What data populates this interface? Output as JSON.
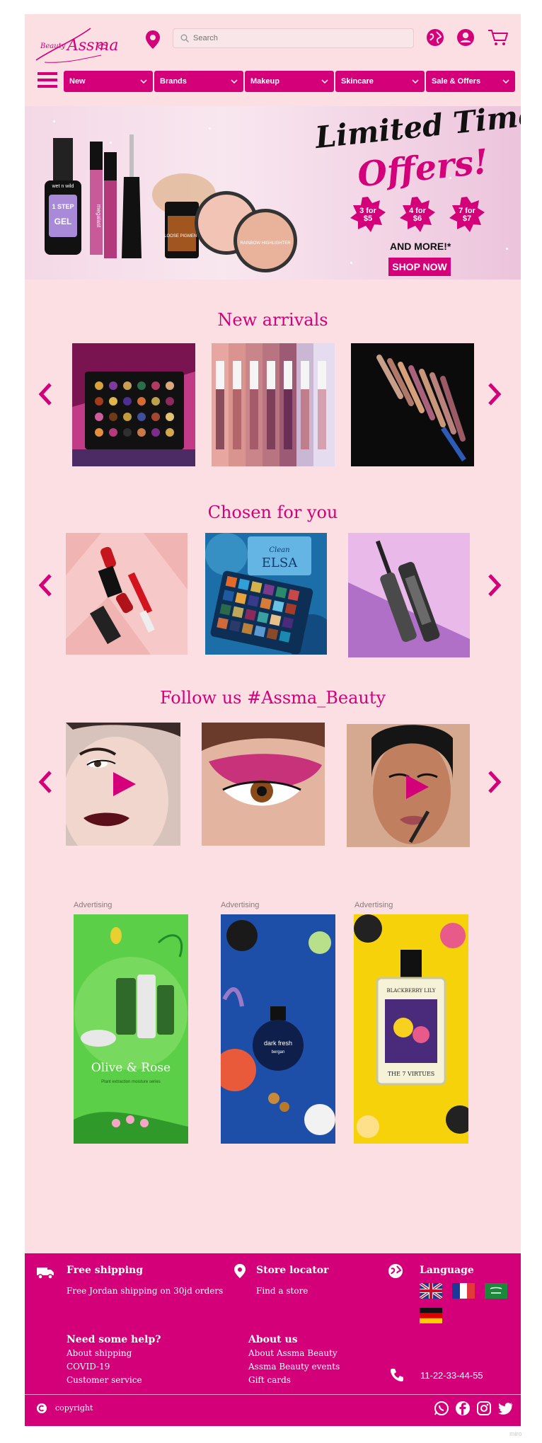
{
  "brand": {
    "name": "Assma",
    "tagline": "Beauty"
  },
  "header": {
    "search_placeholder": "Search"
  },
  "nav": {
    "items": [
      {
        "label": "New"
      },
      {
        "label": "Brands"
      },
      {
        "label": "Makeup"
      },
      {
        "label": "Skincare"
      },
      {
        "label": "Sale & Offers"
      }
    ]
  },
  "banner": {
    "title_line1": "Limited Time",
    "title_line2": "Offers!",
    "deals": [
      {
        "line1": "3 for",
        "line2": "$5"
      },
      {
        "line1": "4 for",
        "line2": "$6"
      },
      {
        "line1": "7 for",
        "line2": "$7"
      }
    ],
    "and_more": "AND MORE!*",
    "cta": "SHOP NOW",
    "product_texts": [
      "wet n wild",
      "1 STEP",
      "GEL",
      "megalast",
      "LOOSE PIGMENT",
      "RAINBOW HIGHLIGHTER"
    ]
  },
  "sections": {
    "new_arrivals": "New arrivals",
    "chosen_for_you": "Chosen for you",
    "follow_us": "Follow us #Assma_Beauty"
  },
  "chosen_texts": {
    "elsa": "ELSA",
    "brand": "Clean"
  },
  "ads": {
    "label": "Advertising",
    "items": [
      {
        "title": "Olive & Rose",
        "sub": "Plant extraction moisture series"
      },
      {
        "title": "dark fresh",
        "sub": "bergan"
      },
      {
        "title": "BLACKBERRY LILY",
        "sub": "THE 7 VIRTUES"
      }
    ]
  },
  "footer": {
    "free_shipping_title": "Free shipping",
    "free_shipping_text": "Free Jordan shipping on 30jd orders",
    "store_locator_title": "Store locator",
    "store_locator_link": "Find a store",
    "language_title": "Language",
    "help_title": "Need some help?",
    "help_links": [
      "About shipping",
      "COVID-19",
      "Customer service"
    ],
    "about_title": "About us",
    "about_links": [
      "About Assma Beauty",
      "Assma Beauty events",
      "Gift cards"
    ],
    "phone": "11-22-33-44-55",
    "copyright": "copyright"
  },
  "watermark": "miro",
  "colors": {
    "accent": "#d3007a",
    "page_bg": "#fbdfe2"
  },
  "icons": [
    "location-pin-icon",
    "search-icon",
    "globe-icon",
    "user-icon",
    "cart-icon",
    "menu-icon",
    "truck-icon",
    "whatsapp-icon",
    "facebook-icon",
    "instagram-icon",
    "twitter-icon",
    "phone-icon",
    "copyright-icon"
  ]
}
